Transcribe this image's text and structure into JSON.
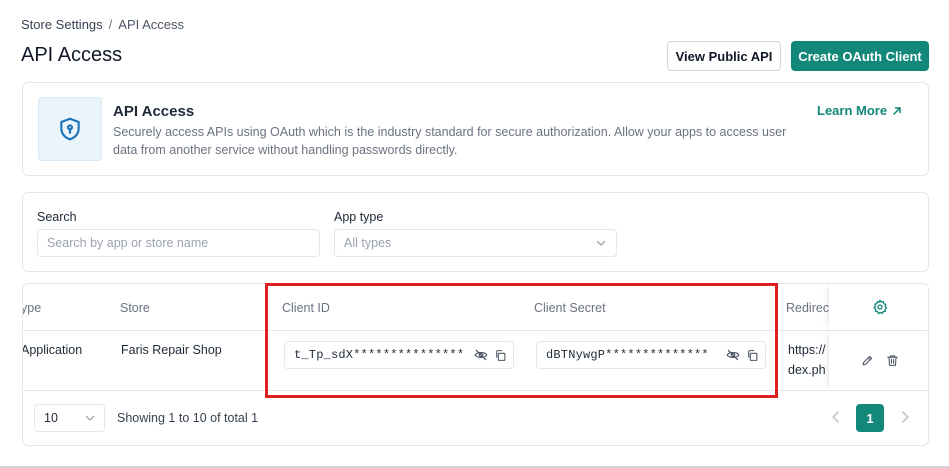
{
  "breadcrumb": {
    "parent": "Store Settings",
    "separator": "/",
    "current": "API Access"
  },
  "page": {
    "title": "API Access"
  },
  "header_buttons": {
    "view_public_api": "View Public API",
    "create_oauth_client": "Create OAuth Client"
  },
  "info_card": {
    "title": "API Access",
    "description": "Securely access APIs using OAuth which is the industry standard for secure authorization. Allow your apps to access user data from another service without handling passwords directly.",
    "learn_more": "Learn More",
    "icon": "shield-icon"
  },
  "filters": {
    "search_label": "Search",
    "search_placeholder": "Search by app or store name",
    "app_type_label": "App type",
    "app_type_value": "All types"
  },
  "table": {
    "columns": [
      "ype",
      "Store",
      "Client ID",
      "Client Secret",
      "Redirec"
    ],
    "rows": [
      {
        "type": "Application",
        "store": "Faris Repair Shop",
        "client_id": "t_Tp_sdX***************",
        "client_secret": "dBTNywgP**************",
        "redirect_line1": "https://",
        "redirect_line2": "dex.ph"
      }
    ]
  },
  "pagination": {
    "page_size": "10",
    "summary": "Showing 1 to 10 of total 1",
    "current_page": "1"
  },
  "colors": {
    "accent": "#13877a",
    "highlight": "#e02020",
    "border": "#e5e7eb"
  }
}
